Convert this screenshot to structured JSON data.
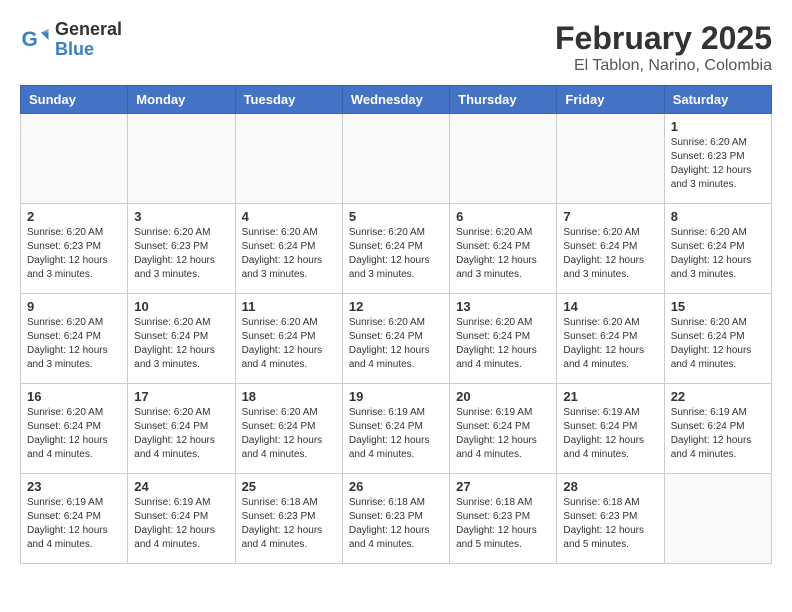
{
  "header": {
    "logo_general": "General",
    "logo_blue": "Blue",
    "main_title": "February 2025",
    "subtitle": "El Tablon, Narino, Colombia"
  },
  "calendar": {
    "days_of_week": [
      "Sunday",
      "Monday",
      "Tuesday",
      "Wednesday",
      "Thursday",
      "Friday",
      "Saturday"
    ],
    "weeks": [
      [
        {
          "day": "",
          "info": ""
        },
        {
          "day": "",
          "info": ""
        },
        {
          "day": "",
          "info": ""
        },
        {
          "day": "",
          "info": ""
        },
        {
          "day": "",
          "info": ""
        },
        {
          "day": "",
          "info": ""
        },
        {
          "day": "1",
          "info": "Sunrise: 6:20 AM\nSunset: 6:23 PM\nDaylight: 12 hours\nand 3 minutes."
        }
      ],
      [
        {
          "day": "2",
          "info": "Sunrise: 6:20 AM\nSunset: 6:23 PM\nDaylight: 12 hours\nand 3 minutes."
        },
        {
          "day": "3",
          "info": "Sunrise: 6:20 AM\nSunset: 6:23 PM\nDaylight: 12 hours\nand 3 minutes."
        },
        {
          "day": "4",
          "info": "Sunrise: 6:20 AM\nSunset: 6:24 PM\nDaylight: 12 hours\nand 3 minutes."
        },
        {
          "day": "5",
          "info": "Sunrise: 6:20 AM\nSunset: 6:24 PM\nDaylight: 12 hours\nand 3 minutes."
        },
        {
          "day": "6",
          "info": "Sunrise: 6:20 AM\nSunset: 6:24 PM\nDaylight: 12 hours\nand 3 minutes."
        },
        {
          "day": "7",
          "info": "Sunrise: 6:20 AM\nSunset: 6:24 PM\nDaylight: 12 hours\nand 3 minutes."
        },
        {
          "day": "8",
          "info": "Sunrise: 6:20 AM\nSunset: 6:24 PM\nDaylight: 12 hours\nand 3 minutes."
        }
      ],
      [
        {
          "day": "9",
          "info": "Sunrise: 6:20 AM\nSunset: 6:24 PM\nDaylight: 12 hours\nand 3 minutes."
        },
        {
          "day": "10",
          "info": "Sunrise: 6:20 AM\nSunset: 6:24 PM\nDaylight: 12 hours\nand 3 minutes."
        },
        {
          "day": "11",
          "info": "Sunrise: 6:20 AM\nSunset: 6:24 PM\nDaylight: 12 hours\nand 4 minutes."
        },
        {
          "day": "12",
          "info": "Sunrise: 6:20 AM\nSunset: 6:24 PM\nDaylight: 12 hours\nand 4 minutes."
        },
        {
          "day": "13",
          "info": "Sunrise: 6:20 AM\nSunset: 6:24 PM\nDaylight: 12 hours\nand 4 minutes."
        },
        {
          "day": "14",
          "info": "Sunrise: 6:20 AM\nSunset: 6:24 PM\nDaylight: 12 hours\nand 4 minutes."
        },
        {
          "day": "15",
          "info": "Sunrise: 6:20 AM\nSunset: 6:24 PM\nDaylight: 12 hours\nand 4 minutes."
        }
      ],
      [
        {
          "day": "16",
          "info": "Sunrise: 6:20 AM\nSunset: 6:24 PM\nDaylight: 12 hours\nand 4 minutes."
        },
        {
          "day": "17",
          "info": "Sunrise: 6:20 AM\nSunset: 6:24 PM\nDaylight: 12 hours\nand 4 minutes."
        },
        {
          "day": "18",
          "info": "Sunrise: 6:20 AM\nSunset: 6:24 PM\nDaylight: 12 hours\nand 4 minutes."
        },
        {
          "day": "19",
          "info": "Sunrise: 6:19 AM\nSunset: 6:24 PM\nDaylight: 12 hours\nand 4 minutes."
        },
        {
          "day": "20",
          "info": "Sunrise: 6:19 AM\nSunset: 6:24 PM\nDaylight: 12 hours\nand 4 minutes."
        },
        {
          "day": "21",
          "info": "Sunrise: 6:19 AM\nSunset: 6:24 PM\nDaylight: 12 hours\nand 4 minutes."
        },
        {
          "day": "22",
          "info": "Sunrise: 6:19 AM\nSunset: 6:24 PM\nDaylight: 12 hours\nand 4 minutes."
        }
      ],
      [
        {
          "day": "23",
          "info": "Sunrise: 6:19 AM\nSunset: 6:24 PM\nDaylight: 12 hours\nand 4 minutes."
        },
        {
          "day": "24",
          "info": "Sunrise: 6:19 AM\nSunset: 6:24 PM\nDaylight: 12 hours\nand 4 minutes."
        },
        {
          "day": "25",
          "info": "Sunrise: 6:18 AM\nSunset: 6:23 PM\nDaylight: 12 hours\nand 4 minutes."
        },
        {
          "day": "26",
          "info": "Sunrise: 6:18 AM\nSunset: 6:23 PM\nDaylight: 12 hours\nand 4 minutes."
        },
        {
          "day": "27",
          "info": "Sunrise: 6:18 AM\nSunset: 6:23 PM\nDaylight: 12 hours\nand 5 minutes."
        },
        {
          "day": "28",
          "info": "Sunrise: 6:18 AM\nSunset: 6:23 PM\nDaylight: 12 hours\nand 5 minutes."
        },
        {
          "day": "",
          "info": ""
        }
      ]
    ]
  }
}
